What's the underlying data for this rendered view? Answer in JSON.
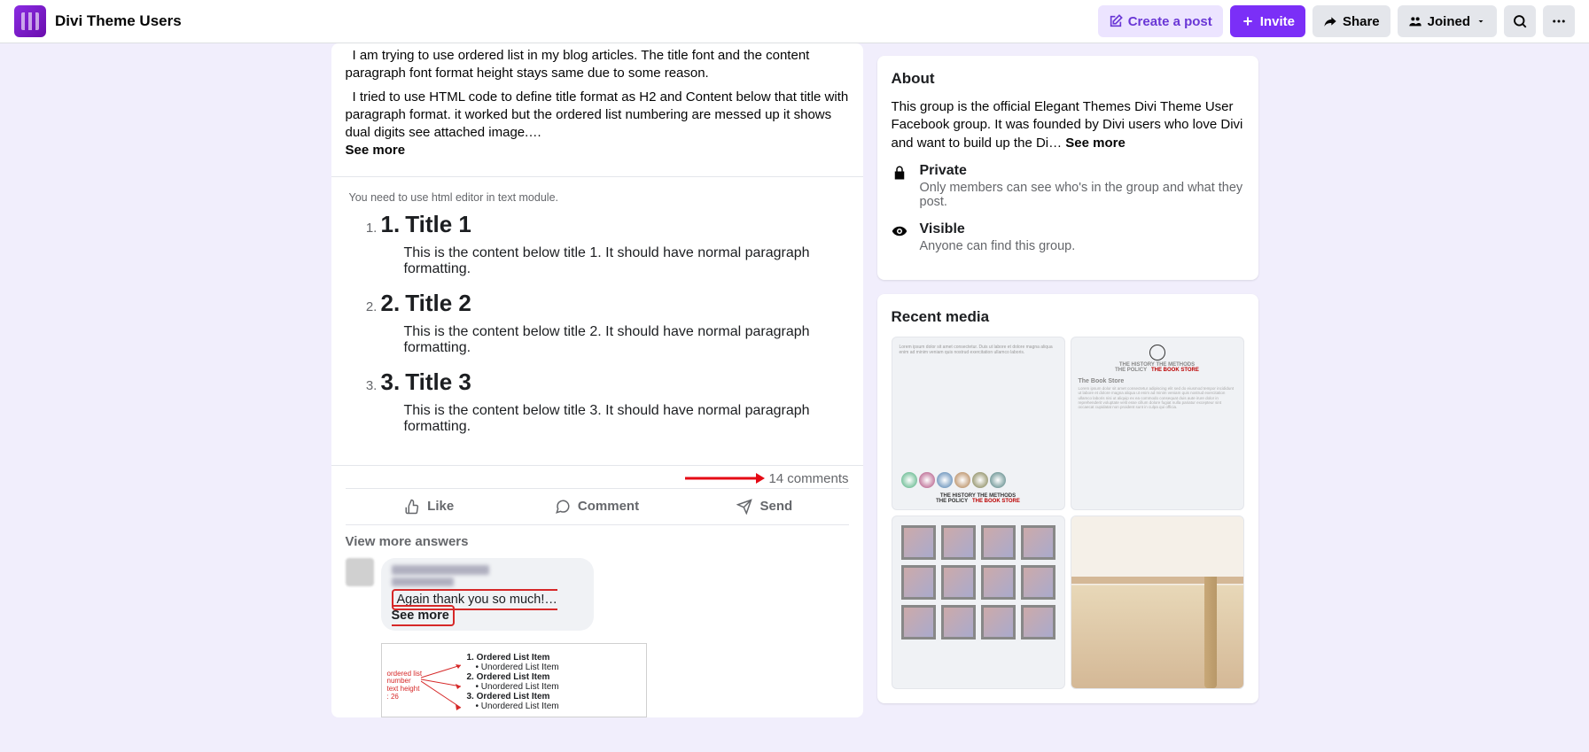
{
  "header": {
    "group_name": "Divi Theme Users",
    "create_post": "Create a post",
    "invite": "Invite",
    "share": "Share",
    "joined": "Joined"
  },
  "post": {
    "intro_line": "I am trying to use ordered list in my blog articles. The title font and the content paragraph font format height stays same due to some reason.",
    "para2_prefix": "I tried to use HTML code to define title format as H2 and Content below that title with paragraph format. it worked but the ordered list numbering are messed up it shows dual digits see attached image.… ",
    "see_more": "See more",
    "attached_hint": "You need to use html editor in text module.",
    "items": [
      {
        "num": "1.",
        "title": "Title 1",
        "content": "This is the content below title 1. It should have normal paragraph formatting."
      },
      {
        "num": "2.",
        "title": "Title 2",
        "content": "This is the content below title 2. It should have normal paragraph formatting."
      },
      {
        "num": "3.",
        "title": "Title 3",
        "content": "This is the content below title 3. It should have normal paragraph formatting."
      }
    ],
    "comments_count": "14 comments",
    "actions": {
      "like": "Like",
      "comment": "Comment",
      "send": "Send"
    },
    "view_more": "View more answers",
    "reply": {
      "text_prefix": "Again thank you so much!… ",
      "see_more": "See more",
      "nested_label": "ordered list number text height : 26",
      "nested_items": {
        "o1": "1. Ordered List Item",
        "u1": "• Unordered List Item",
        "o2": "2. Ordered List Item",
        "u2": "• Unordered List Item",
        "o3": "3. Ordered List Item",
        "u3": "• Unordered List Item"
      }
    }
  },
  "about": {
    "heading": "About",
    "text_prefix": "This group is the official Elegant Themes Divi Theme User Facebook group. It was founded by Divi users who love Divi and want to build up the Di… ",
    "see_more": "See more",
    "private_title": "Private",
    "private_sub": "Only members can see who's in the group and what they post.",
    "visible_title": "Visible",
    "visible_sub": "Anyone can find this group."
  },
  "media": {
    "heading": "Recent media",
    "m1": {
      "foot1": "THE HISTORY   THE METHODS",
      "foot2": "THE POLICY",
      "foot3": "THE BOOK STORE"
    },
    "m2": {
      "h1": "THE HISTORY   THE METHODS",
      "h2": "THE POLICY",
      "h3": "THE BOOK STORE",
      "title": "The Book Store"
    }
  }
}
